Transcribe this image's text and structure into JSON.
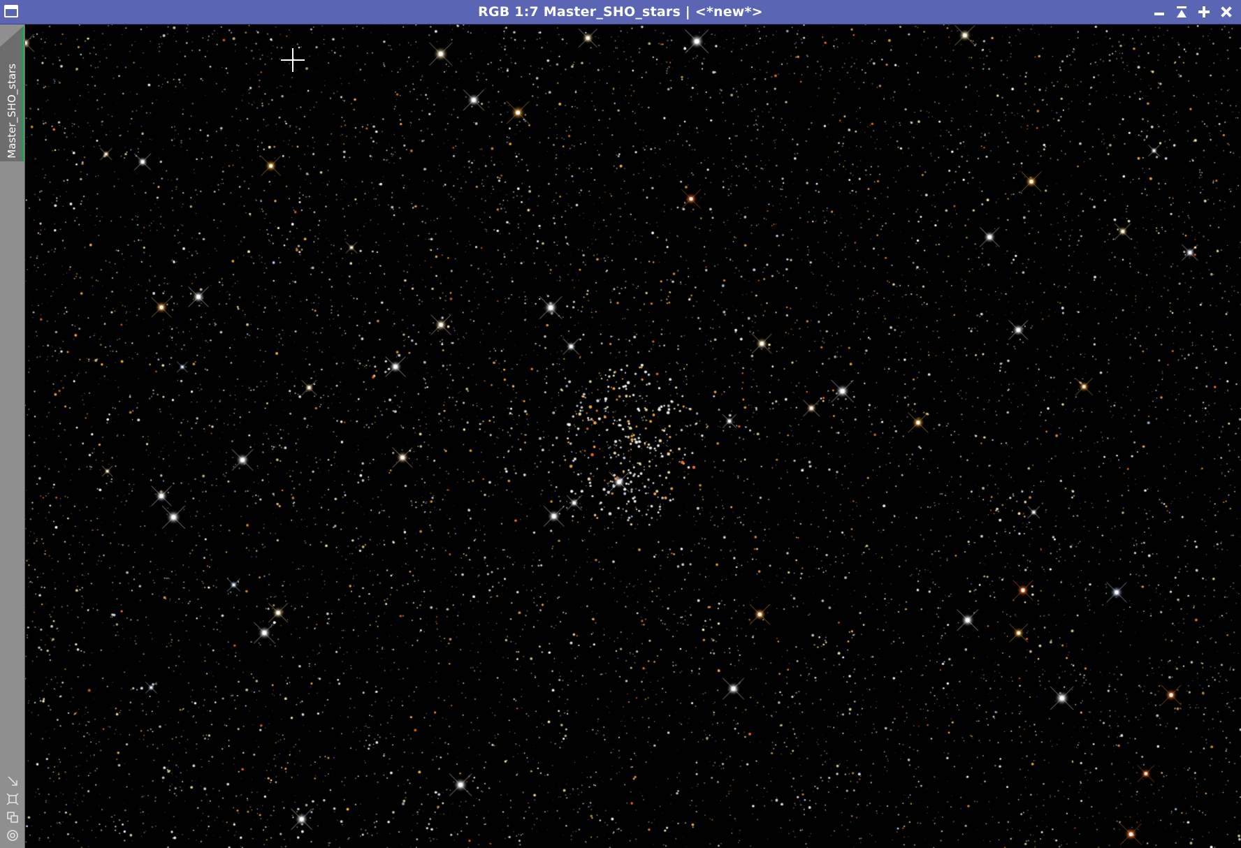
{
  "window": {
    "title": "RGB 1:7 Master_SHO_stars | <*new*>",
    "titlebar_color": "#5a66b3",
    "controls": [
      "minimize-icon",
      "shade-icon",
      "maximize-icon",
      "close-icon"
    ]
  },
  "sidebar": {
    "view_tab_label": "Master_SHO_stars",
    "active_indicator_color": "#1e9e4e",
    "tools": [
      "fit-view-icon",
      "zoom-to-fit-icon",
      "clone-view-icon",
      "target-icon"
    ]
  },
  "image": {
    "subject": "star field with open star cluster",
    "colormode": "RGB",
    "zoom": "1:7",
    "background": "#000000",
    "star_palette": [
      "#ffffff",
      "#ffe6b0",
      "#ffb347",
      "#ff7a2a",
      "#cfe3ff"
    ]
  }
}
